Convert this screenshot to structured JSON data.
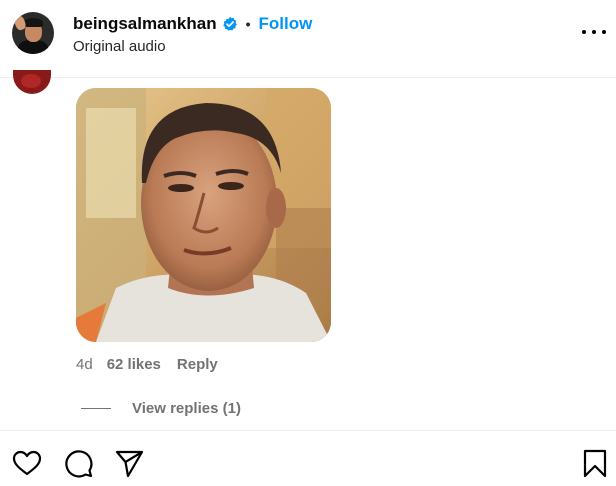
{
  "header": {
    "username": "beingsalmankhan",
    "separator": "•",
    "follow_label": "Follow",
    "subtitle": "Original audio",
    "verified_icon": "verified-badge-icon",
    "more_icon": "more-options-icon"
  },
  "comment": {
    "age": "4d",
    "likes": "62 likes",
    "reply_label": "Reply",
    "view_replies": "View replies (1)"
  },
  "actions": {
    "like_icon": "heart-icon",
    "comment_icon": "comment-icon",
    "share_icon": "send-icon",
    "save_icon": "bookmark-icon"
  },
  "colors": {
    "accent": "#0095f6",
    "muted": "#737373",
    "verified": "#0095f6"
  }
}
